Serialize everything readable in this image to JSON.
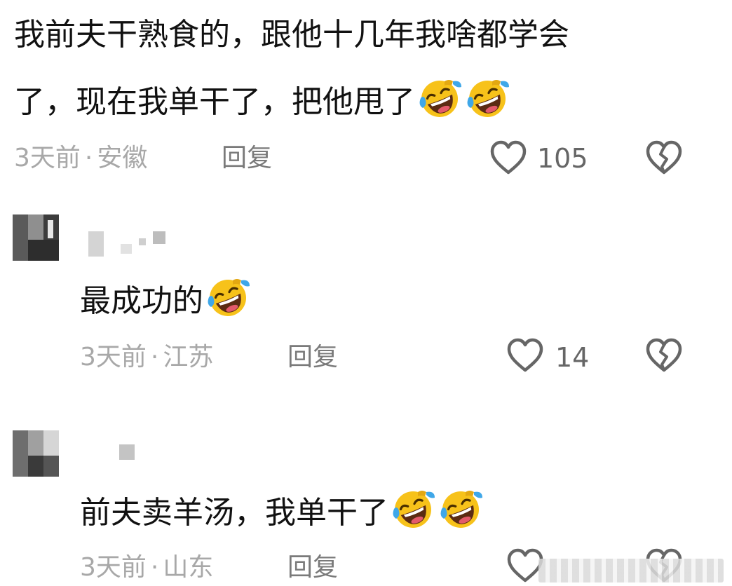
{
  "comments": [
    {
      "text_line1": "我前夫干熟食的，跟他十几年我啥都学会",
      "text_line2": "了，现在我单干了，把他甩了",
      "time": "3天前",
      "location": "安徽",
      "reply_label": "回复",
      "like_count": "105"
    },
    {
      "text": "最成功的",
      "time": "3天前",
      "location": "江苏",
      "reply_label": "回复",
      "like_count": "14"
    },
    {
      "text": "前夫卖羊汤，我单干了",
      "time": "3天前",
      "location": "山东",
      "reply_label": "回复"
    }
  ],
  "meta_separator": "·",
  "icons": {
    "like": "heart-outline-icon",
    "dislike": "broken-heart-icon",
    "emoji": "rofl-crying-laughing-emoji"
  },
  "colors": {
    "text": "#111111",
    "meta": "#a8a8a8",
    "icon": "#666666",
    "emoji_face": "#f7c21a"
  }
}
